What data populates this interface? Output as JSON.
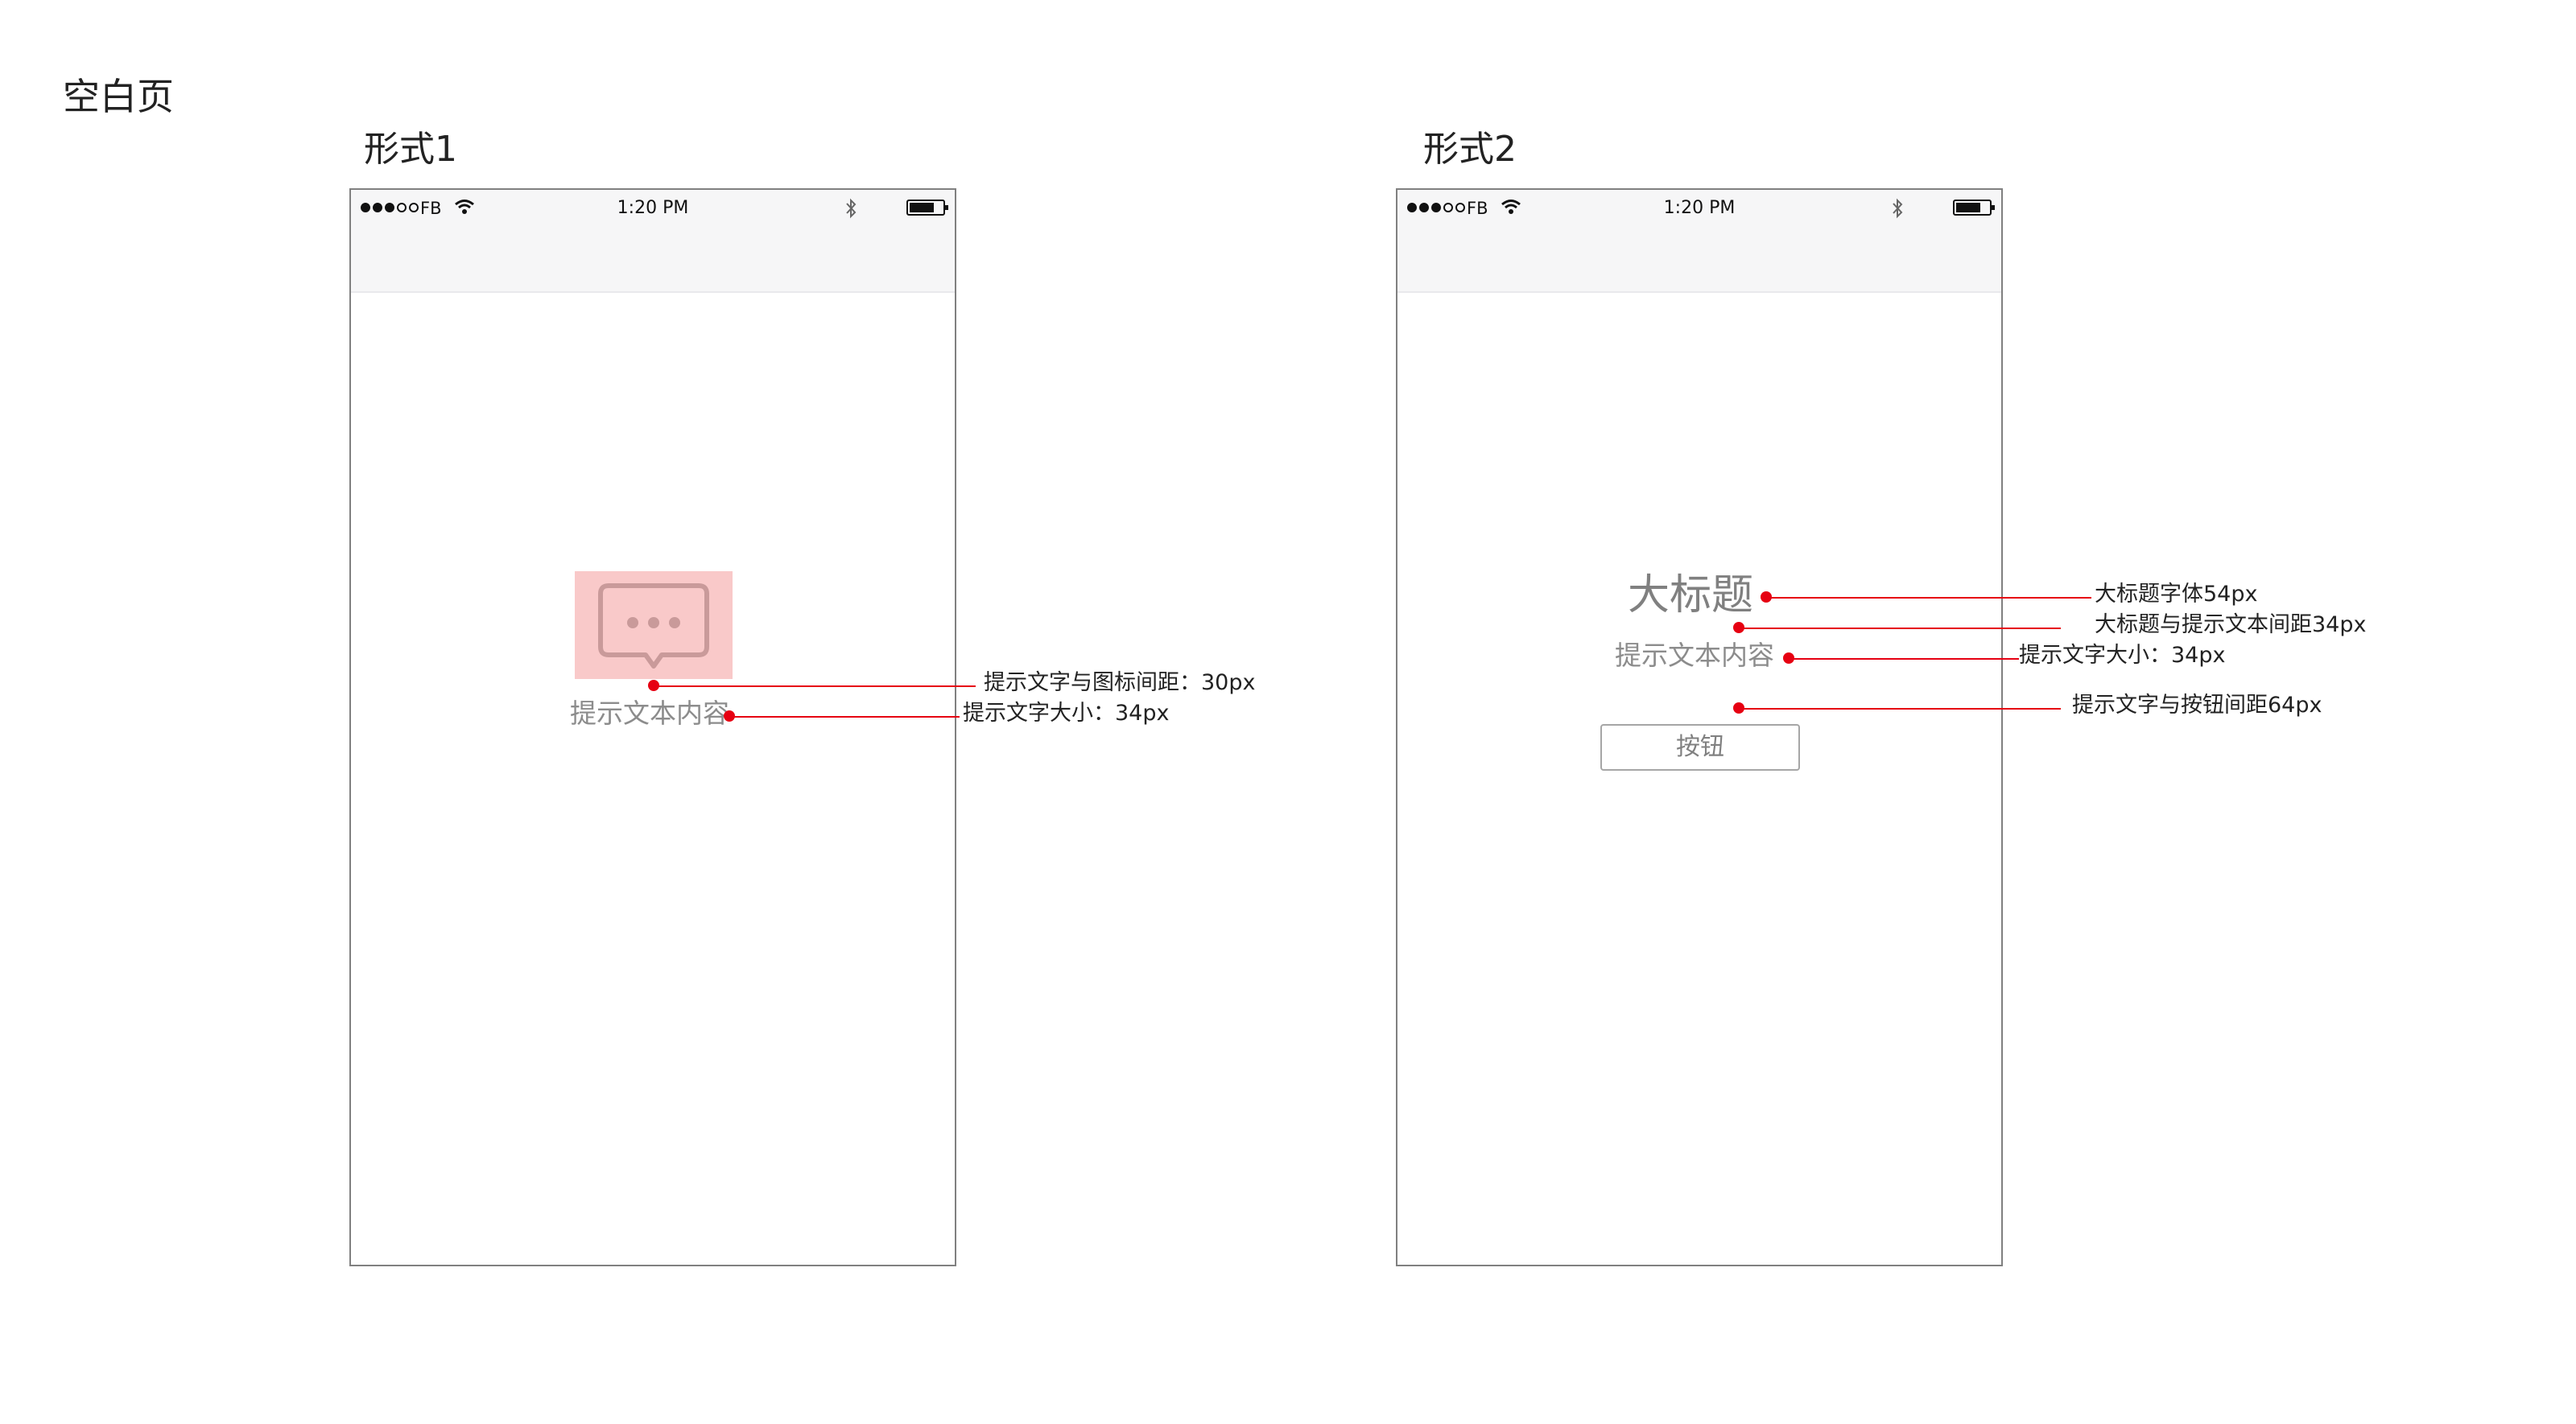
{
  "page_title": "空白页",
  "status_bar": {
    "carrier": "FB",
    "time": "1:20 PM",
    "signal_bars_filled": 3,
    "signal_bars_total": 5
  },
  "forms": [
    {
      "title": "形式1",
      "icon": "chat-bubble-icon",
      "hint_text": "提示文本内容",
      "annotations": [
        "提示文字与图标间距：30px",
        "提示文字大小：34px"
      ]
    },
    {
      "title": "形式2",
      "big_title": "大标题",
      "hint_text": "提示文本内容",
      "button_label": "按钮",
      "annotations": [
        "大标题字体54px",
        "大标题与提示文本间距34px",
        "提示文字大小：34px",
        "提示文字与按钮间距64px"
      ]
    }
  ],
  "colors": {
    "annotation": "#e60012",
    "icon_highlight": "#f9c9c9",
    "hint_text": "#8c8c8c",
    "navbar": "#f6f6f7"
  }
}
